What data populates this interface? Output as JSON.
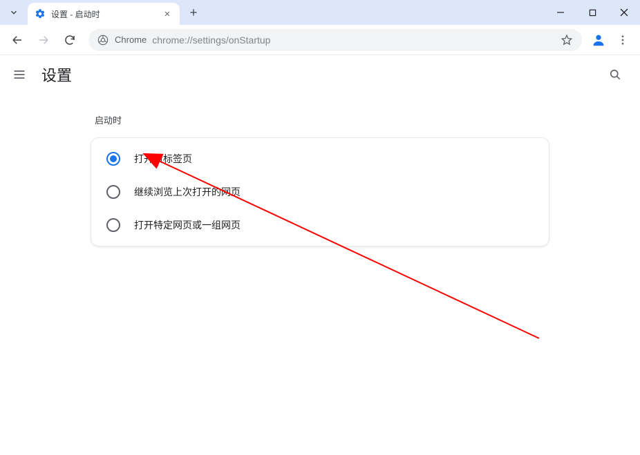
{
  "window": {
    "tab_title": "设置 - 启动时",
    "scheme_label": "Chrome",
    "url": "chrome://settings/onStartup"
  },
  "settings": {
    "header_title": "设置",
    "section_label": "启动时",
    "options": [
      {
        "label": "打开新标签页",
        "selected": true
      },
      {
        "label": "继续浏览上次打开的网页",
        "selected": false
      },
      {
        "label": "打开特定网页或一组网页",
        "selected": false
      }
    ]
  }
}
